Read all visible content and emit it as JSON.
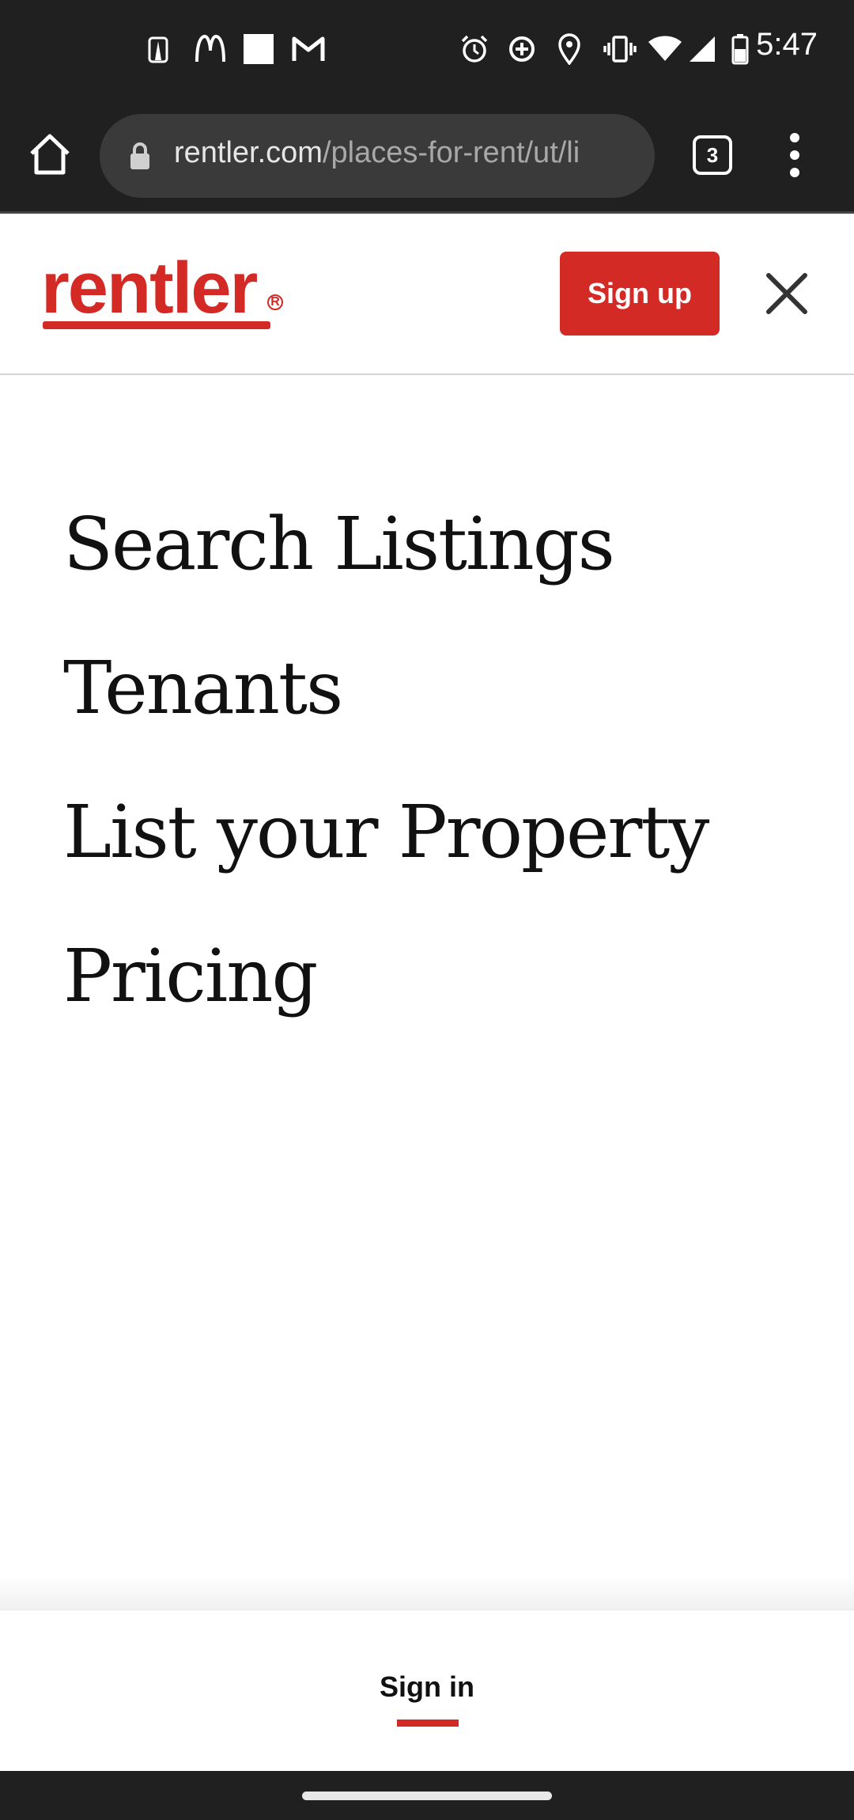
{
  "status_bar": {
    "time": "5:47",
    "left_icons": [
      "app-notification-icon",
      "mcdonalds-icon",
      "white-square-icon",
      "gmail-icon"
    ],
    "right_icons": [
      "alarm-icon",
      "data-saver-icon",
      "location-icon",
      "vibrate-icon",
      "wifi-icon",
      "signal-icon",
      "battery-icon"
    ]
  },
  "browser": {
    "url_host": "rentler.com",
    "url_path": "/places-for-rent/ut/li",
    "tab_count": "3"
  },
  "header": {
    "logo_text": "rentler",
    "logo_registered": "R",
    "signup_label": "Sign up"
  },
  "nav": {
    "items": [
      {
        "label": "Search Listings"
      },
      {
        "label": "Tenants"
      },
      {
        "label": "List your Property"
      },
      {
        "label": "Pricing"
      }
    ]
  },
  "footer": {
    "signin_label": "Sign in"
  },
  "colors": {
    "brand_red": "#d42a25",
    "system_bar": "#202020"
  }
}
